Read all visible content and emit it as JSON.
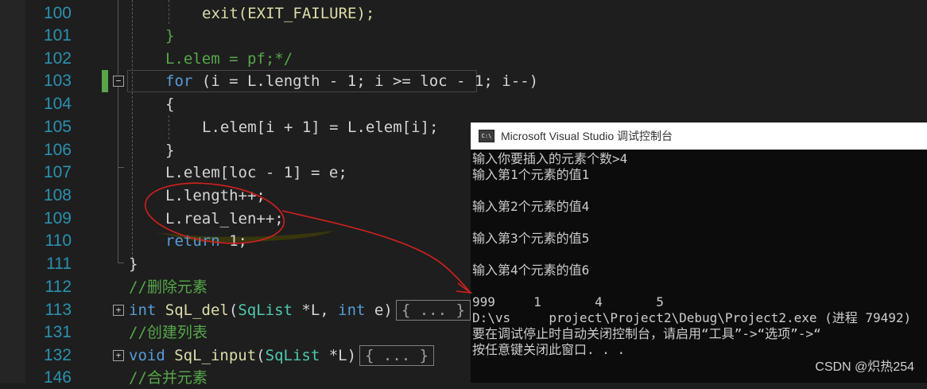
{
  "editor": {
    "line_numbers": [
      "100",
      "101",
      "102",
      "103",
      "104",
      "105",
      "106",
      "107",
      "108",
      "109",
      "110",
      "111",
      "112",
      "113",
      "131",
      "132",
      "146"
    ],
    "lines": {
      "l100": "exit(EXIT_FAILURE);",
      "l101": "}",
      "l102": "L.elem = pf;*/",
      "l103_kw": "for",
      "l103_rest": " (i = L.length - 1; i >= loc - 1; i--)",
      "l104": "{",
      "l105": "L.elem[i + 1] = L.elem[i];",
      "l106": "}",
      "l107": "L.elem[loc - 1] = e;",
      "l108": "L.length++;",
      "l109": "L.real_len++;",
      "l110_kw": "return",
      "l110_rest": " 1;",
      "l111": "}",
      "l112": "//删除元素",
      "l113_type": "int",
      "l113_fn": "SqL_del",
      "l113_param_type": "SqList",
      "l113_mid": " *L, ",
      "l113_param2_type": "int",
      "l113_end": " e)",
      "l131": "//创建列表",
      "l132_type": "void",
      "l132_fn": "SqL_input",
      "l132_param_type": "SqList",
      "l132_end": " *L)",
      "l146": "//合并元素",
      "collapsed_label": "{ ... }"
    }
  },
  "console": {
    "icon_label": "C:\\",
    "title": "Microsoft Visual Studio 调试控制台",
    "lines": [
      "输入你要插入的元素个数>4",
      "输入第1个元素的值1",
      "",
      "输入第2个元素的值4",
      "",
      "输入第3个元素的值5",
      "",
      "输入第4个元素的值6",
      "",
      "999     1       4       5",
      "D:\\vs     project\\Project2\\Debug\\Project2.exe (进程 79492)",
      "要在调试停止时自动关闭控制台，请启用“工具”->“选项”->“",
      "按任意键关闭此窗口. . ."
    ]
  },
  "watermark": "CSDN @炽热254",
  "colors": {
    "annotation": "#d42020",
    "highlight": "#3b3a0a",
    "line_number": "#2b91af"
  }
}
